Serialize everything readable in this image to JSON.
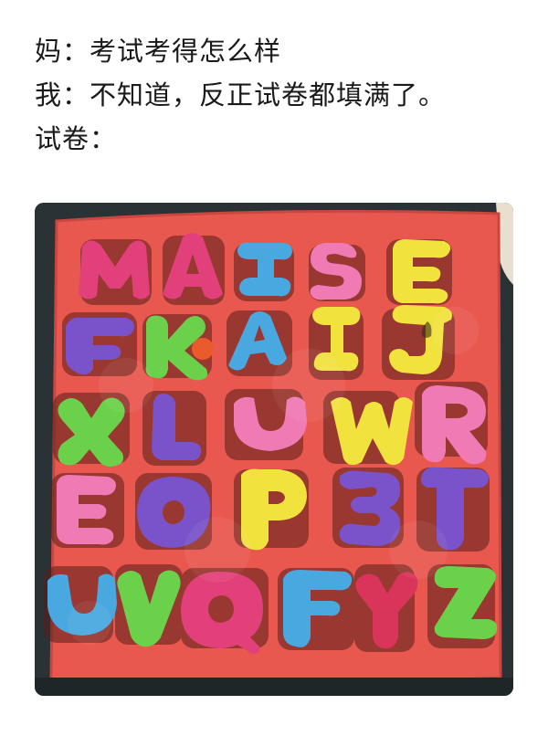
{
  "caption": {
    "line1": "妈：考试考得怎么样",
    "line2": "我：不知道，反正试卷都填满了。",
    "line3": "试卷："
  },
  "photo": {
    "subject": "foam alphabet puzzle board with mismatched letters",
    "board_color": "#e8584f",
    "background_color": "#2a3236",
    "rows": [
      [
        "M",
        "A",
        "I",
        "S",
        "E"
      ],
      [
        "F",
        "K",
        "A",
        "I",
        "J"
      ],
      [
        "X",
        "L",
        "U",
        "W",
        "R"
      ],
      [
        "E",
        "O",
        "P",
        "3",
        "T"
      ],
      [
        "U",
        "V",
        "Q",
        "F",
        "Y",
        "Z"
      ]
    ]
  }
}
